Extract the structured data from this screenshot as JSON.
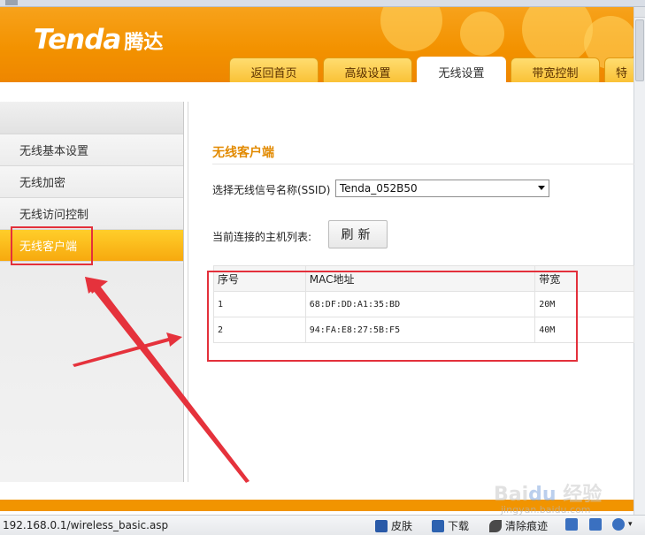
{
  "header": {
    "brand": "Tenda",
    "brand_cn": "腾达",
    "tabs": [
      {
        "label": "返回首页"
      },
      {
        "label": "高级设置"
      },
      {
        "label": "无线设置"
      },
      {
        "label": "带宽控制"
      },
      {
        "label": "特"
      }
    ],
    "active_tab": "无线设置"
  },
  "sidebar": {
    "items": [
      {
        "label": "无线基本设置"
      },
      {
        "label": "无线加密"
      },
      {
        "label": "无线访问控制"
      },
      {
        "label": "无线客户端"
      }
    ],
    "active_item": "无线客户端"
  },
  "main": {
    "title": "无线客户端",
    "ssid_label": "选择无线信号名称(SSID)",
    "ssid_value": "Tenda_052B50",
    "host_list_label": "当前连接的主机列表:",
    "refresh_label": "刷新",
    "table": {
      "headers": [
        "序号",
        "MAC地址",
        "带宽"
      ],
      "rows": [
        [
          "1",
          "68:DF:DD:A1:35:BD",
          "20M"
        ],
        [
          "2",
          "94:FA:E8:27:5B:F5",
          "40M"
        ]
      ]
    }
  },
  "statusbar": {
    "url": "192.168.0.1/wireless_basic.asp",
    "skin": "皮肤",
    "download": "下载",
    "clear_history": "清除痕迹"
  },
  "colors": {
    "brand_orange": "#f39200",
    "active_tab_text": "#333333",
    "title_orange": "#e28a00",
    "annotation_red": "#e3303b"
  }
}
